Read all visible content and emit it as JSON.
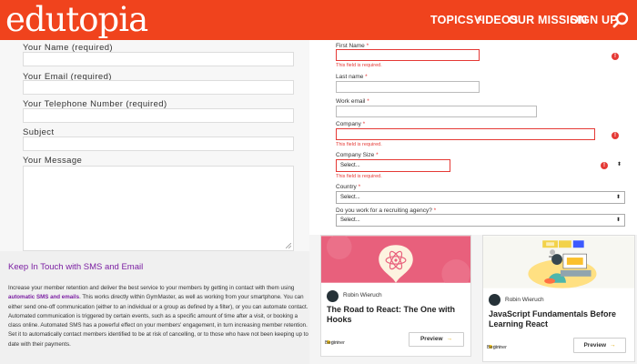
{
  "header": {
    "logo": "edutopia",
    "nav": {
      "topics": "TOPICS",
      "videos": "VIDEOS",
      "mission": "OUR MISSION",
      "signup": "SIGN UP"
    }
  },
  "contact_form": {
    "name_label": "Your Name (required)",
    "email_label": "Your Email (required)",
    "phone_label": "Your Telephone Number (required)",
    "subject_label": "Subject",
    "message_label": "Your Message"
  },
  "promo": {
    "title": "Keep In Touch with SMS and Email",
    "body_before": "Increase your member retention and deliver the best service to your members by getting in contact with them using ",
    "body_link": "automatic SMS and emails",
    "body_after": ". This works directly within GymMaster, as well as working from your smartphone. You can either send one-off communication (either to an individual or a group as defined by a filter), or you can automate contact. Automated communication is triggered by certain events, such as a specific amount of time after a visit, or booking a class online. Automated SMS has a powerful effect on your members' engagement, in turn increasing member retention. Set it to automatically contact members identified to be at risk of cancelling, or to those who have not been keeping up to date with their payments."
  },
  "lead_form": {
    "first_name_label": "First Name",
    "last_name_label": "Last name",
    "work_email_label": "Work email",
    "company_label": "Company",
    "company_size_label": "Company Size",
    "country_label": "Country",
    "agency_label": "Do you work for a recruiting agency?",
    "required_mark": "*",
    "error_text": "This field is required.",
    "select_placeholder": "Select..."
  },
  "cards": [
    {
      "author": "Robin Wieruch",
      "title": "The Road to React: The One with Hooks",
      "level": "Beginner",
      "level_filled": 1,
      "level_total": 3,
      "button": "Preview"
    },
    {
      "author": "Robin Wieruch",
      "title": "JavaScript Fundamentals Before Learning React",
      "level": "Beginner",
      "level_filled": 1,
      "level_total": 3,
      "button": "Preview"
    }
  ],
  "colors": {
    "brand": "#f0431d",
    "error": "#e53935",
    "link": "#7b1fa2",
    "react_card_bg": "#e8607c"
  }
}
